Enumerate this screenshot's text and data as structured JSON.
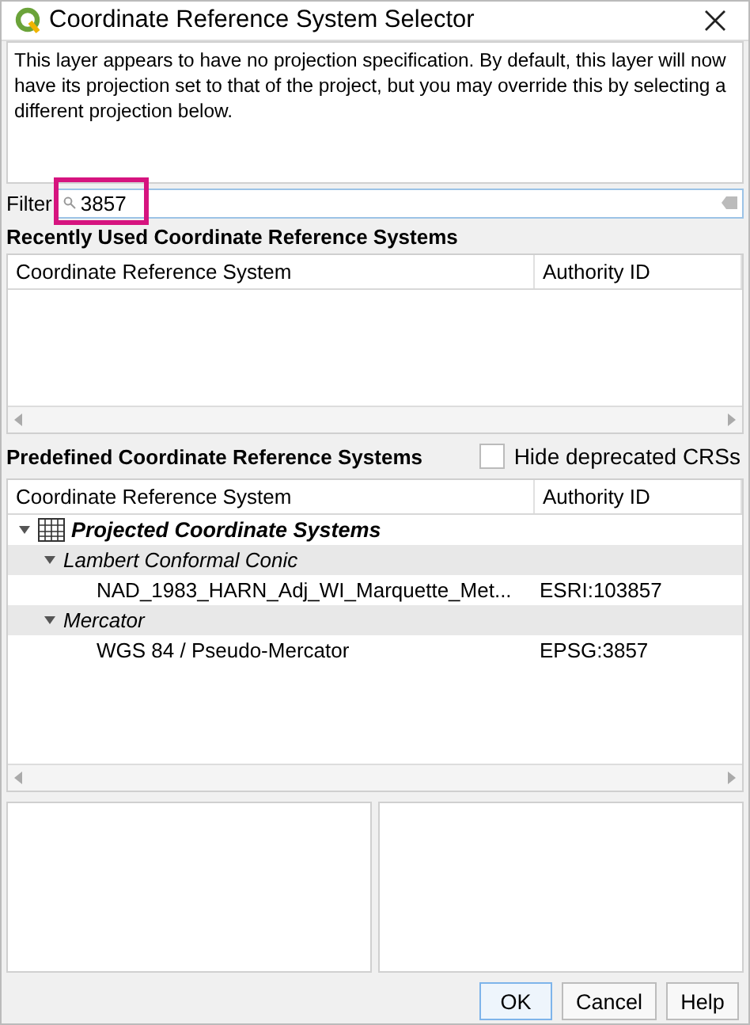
{
  "window": {
    "title": "Coordinate Reference System Selector"
  },
  "message": "This layer appears to have no projection specification. By default, this layer will now have its projection set to that of the project, but you may override this by selecting a different projection below.",
  "filter": {
    "label": "Filter",
    "value": "3857",
    "highlighted": true
  },
  "recent": {
    "heading": "Recently Used Coordinate Reference Systems",
    "columns": [
      "Coordinate Reference System",
      "Authority ID"
    ]
  },
  "predefined": {
    "heading": "Predefined Coordinate Reference Systems",
    "hide_deprecated": {
      "label": "Hide deprecated CRSs",
      "checked": false
    },
    "columns": [
      "Coordinate Reference System",
      "Authority ID"
    ],
    "tree": [
      {
        "label": "Projected Coordinate Systems",
        "kind": "root",
        "expanded": true,
        "children": [
          {
            "label": "Lambert Conformal Conic",
            "kind": "group",
            "expanded": true,
            "children": [
              {
                "label": "NAD_1983_HARN_Adj_WI_Marquette_Met...",
                "authority_id": "ESRI:103857"
              }
            ]
          },
          {
            "label": "Mercator",
            "kind": "group",
            "expanded": true,
            "children": [
              {
                "label": "WGS 84 / Pseudo-Mercator",
                "authority_id": "EPSG:3857"
              }
            ]
          }
        ]
      }
    ]
  },
  "buttons": [
    "OK",
    "Cancel",
    "Help"
  ]
}
